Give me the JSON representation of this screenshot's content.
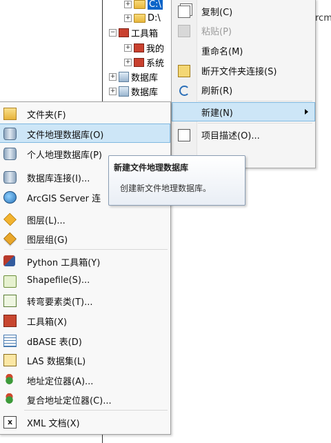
{
  "tree": {
    "nodes": [
      {
        "label": "C:\\",
        "selected": true,
        "icon": "folder-icon"
      },
      {
        "label": "D:\\",
        "selected": false,
        "icon": "folder-icon"
      },
      {
        "label": "工具箱",
        "selected": false,
        "icon": "toolbox-icon"
      },
      {
        "label": "我的",
        "selected": false,
        "icon": "toolbox-icon"
      },
      {
        "label": "系统",
        "selected": false,
        "icon": "toolbox-icon"
      },
      {
        "label": "数据库",
        "selected": false,
        "icon": "database-servers-icon"
      },
      {
        "label": "数据库",
        "selected": false,
        "icon": "database-connections-icon"
      }
    ],
    "partial_text": "rcm"
  },
  "context_menu": {
    "items": [
      {
        "label": "复制(C)",
        "icon": "copy-icon",
        "disabled": false
      },
      {
        "label": "粘贴(P)",
        "icon": "paste-icon",
        "disabled": true
      },
      {
        "label": "重命名(M)",
        "icon": "",
        "disabled": false
      },
      {
        "label": "断开文件夹连接(S)",
        "icon": "disconnect-folder-icon",
        "disabled": false
      },
      {
        "label": "刷新(R)",
        "icon": "refresh-icon",
        "disabled": false
      },
      {
        "label": "新建(N)",
        "icon": "",
        "disabled": false,
        "submenu": true,
        "highlighted": true
      },
      {
        "label": "项目描述(O)...",
        "icon": "item-description-icon",
        "disabled": false
      }
    ]
  },
  "new_submenu": {
    "items": [
      {
        "label": "文件夹(F)",
        "icon": "folder-icon"
      },
      {
        "label": "文件地理数据库(O)",
        "icon": "file-geodatabase-icon",
        "highlighted": true
      },
      {
        "label": "个人地理数据库(P)",
        "icon": "personal-geodatabase-icon"
      },
      {
        "label": "数据库连接(I)...",
        "icon": "database-connection-icon"
      },
      {
        "label": "ArcGIS Server 连",
        "icon": "arcgis-server-icon"
      },
      {
        "label": "图层(L)...",
        "icon": "layer-icon"
      },
      {
        "label": "图层组(G)",
        "icon": "group-layer-icon"
      },
      {
        "label": "Python 工具箱(Y)",
        "icon": "python-toolbox-icon"
      },
      {
        "label": "Shapefile(S)...",
        "icon": "shapefile-icon"
      },
      {
        "label": "转弯要素类(T)...",
        "icon": "turn-feature-class-icon"
      },
      {
        "label": "工具箱(X)",
        "icon": "toolbox-icon"
      },
      {
        "label": "dBASE 表(D)",
        "icon": "dbase-table-icon"
      },
      {
        "label": "LAS 数据集(L)",
        "icon": "las-dataset-icon"
      },
      {
        "label": "地址定位器(A)...",
        "icon": "address-locator-icon"
      },
      {
        "label": "复合地址定位器(C)...",
        "icon": "composite-locator-icon"
      },
      {
        "label": "XML 文档(X)",
        "icon": "xml-document-icon"
      }
    ]
  },
  "tooltip": {
    "title": "新建文件地理数据库",
    "body": "创建新文件地理数据库。"
  }
}
